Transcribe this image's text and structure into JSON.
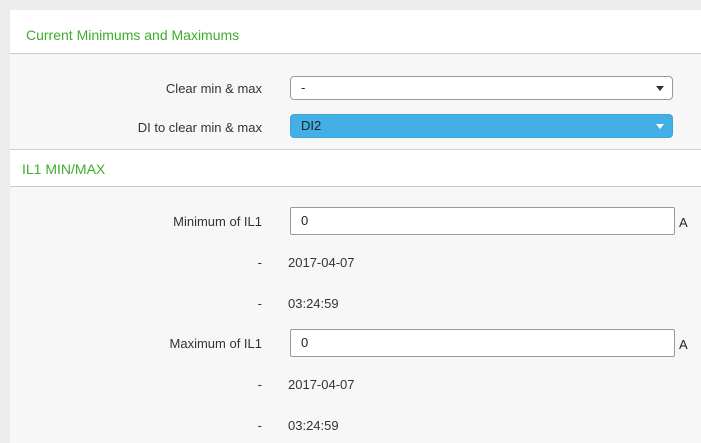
{
  "sections": {
    "current_minmax": {
      "title": "Current Minimums and Maximums"
    },
    "il1_minmax": {
      "title": "IL1 MIN/MAX"
    }
  },
  "clear_min_max": {
    "label": "Clear min & max",
    "selected_value": "-"
  },
  "di_to_clear": {
    "label": "DI to clear min & max",
    "selected_value": "DI2"
  },
  "minimum": {
    "label": "Minimum of IL1",
    "value": "0",
    "unit": "A",
    "date_label": "-",
    "date": "2017-04-07",
    "time_label": "-",
    "time": "03:24:59"
  },
  "maximum": {
    "label": "Maximum of IL1",
    "value": "0",
    "unit": "A",
    "date_label": "-",
    "date": "2017-04-07",
    "time_label": "-",
    "time": "03:24:59"
  },
  "colors": {
    "section_title": "#3dae2b",
    "selected_dropdown": "#42b0e6"
  },
  "icons": {
    "dropdown": "caret-down-icon"
  }
}
